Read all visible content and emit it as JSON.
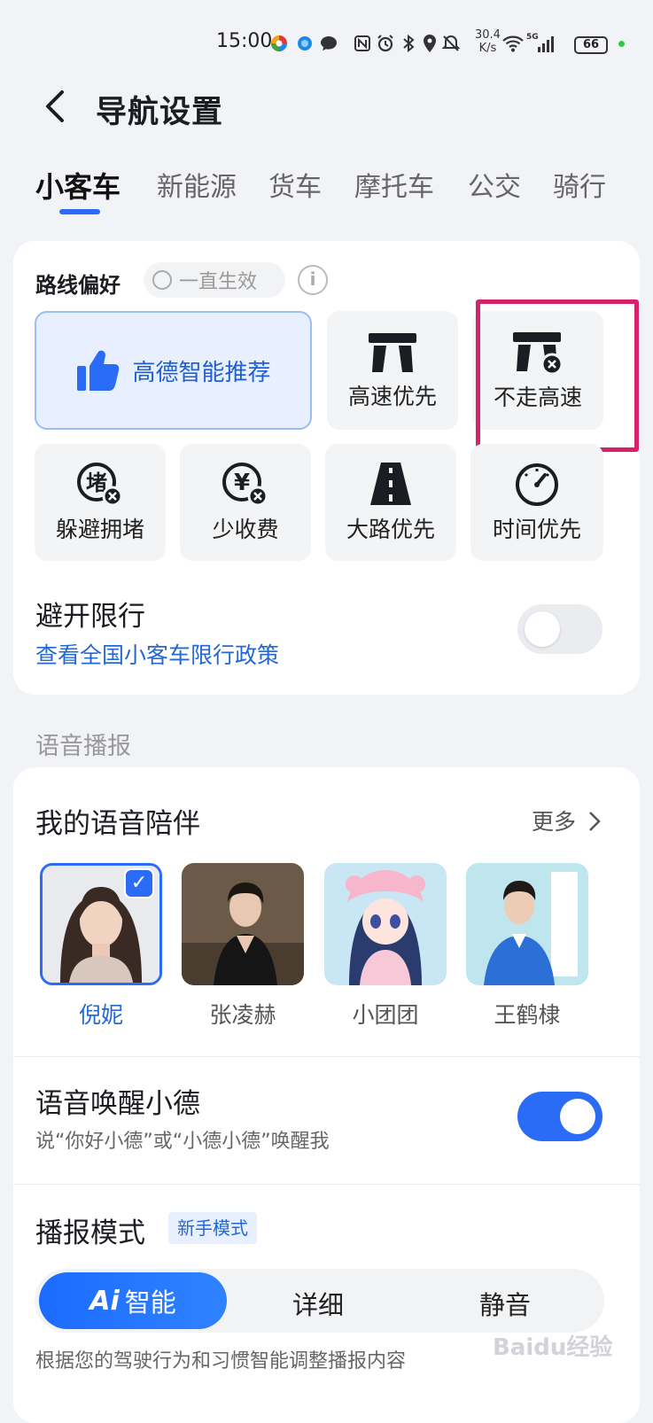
{
  "status_bar": {
    "time": "15:00",
    "speed_value": "30.4",
    "speed_unit": "K/s",
    "signal": "5G",
    "battery": "66"
  },
  "header": {
    "title": "导航设置"
  },
  "tabs": [
    "小客车",
    "新能源",
    "货车",
    "摩托车",
    "公交",
    "骑行"
  ],
  "active_tab": "小客车",
  "route": {
    "label": "路线偏好",
    "always_on": "一直生效",
    "options": {
      "smart": "高德智能推荐",
      "highway_first": "高速优先",
      "avoid_highway": "不走高速",
      "avoid_congestion": "躲避拥堵",
      "less_toll": "少收费",
      "main_road": "大路优先",
      "time_first": "时间优先"
    },
    "congestion_glyph": "堵",
    "toll_glyph": "¥"
  },
  "restriction": {
    "title": "避开限行",
    "link": "查看全国小客车限行政策",
    "enabled": false
  },
  "voice": {
    "section_title": "语音播报",
    "companion_title": "我的语音陪伴",
    "more": "更多",
    "voices": [
      "倪妮",
      "张凌赫",
      "小团团",
      "王鹤棣"
    ],
    "selected_voice": "倪妮",
    "wake_title": "语音唤醒小德",
    "wake_sub": "说“你好小德”或“小德小德”唤醒我",
    "wake_enabled": true,
    "mode_title": "播报模式",
    "mode_badge": "新手模式",
    "mode_ai_prefix": "Ai",
    "mode_ai_label": "智能",
    "mode_detail": "详细",
    "mode_mute": "静音",
    "mode_desc": "根据您的驾驶行为和习惯智能调整播报内容"
  },
  "watermark": "Baidu经验",
  "colors": {
    "accent": "#2a6cf6",
    "highlight": "#d6226a",
    "link": "#2468d6"
  }
}
